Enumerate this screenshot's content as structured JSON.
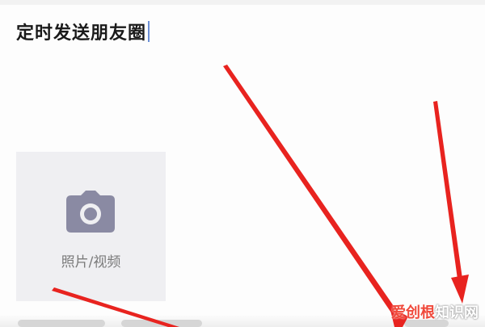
{
  "composer": {
    "text": "定时发送朋友圈"
  },
  "media_tile": {
    "icon": "camera-icon",
    "label": "照片/视频"
  },
  "annotation": {
    "arrow_color": "#e8231f"
  },
  "watermark": {
    "brand": "爱创根",
    "suffix": "知识网"
  }
}
